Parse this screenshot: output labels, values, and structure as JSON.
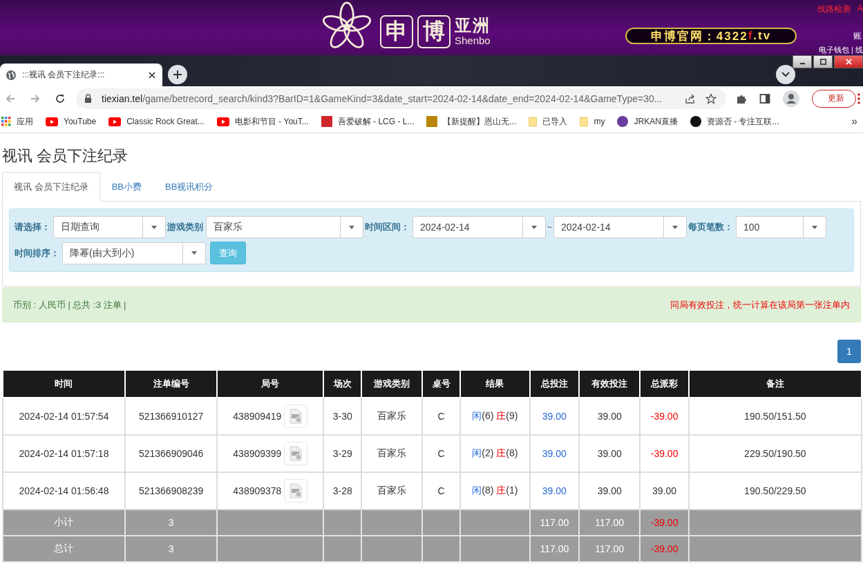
{
  "site_header": {
    "logo_characters": [
      "申",
      "博"
    ],
    "brand_cn": "亚洲",
    "brand_en": "Shenbo",
    "official_site": [
      "申博官网：4322",
      "f",
      ".tv"
    ],
    "top_links": [
      {
        "text": "线路检测",
        "kind": "link"
      },
      {
        "text": "A",
        "kind": "link"
      }
    ],
    "account_label": "账",
    "wallet_link": "电子钱包 | 线"
  },
  "browser": {
    "tab": {
      "title": ":::视讯 会员下注纪录:::"
    },
    "address": {
      "domain": "tiexian.tel",
      "path": "/game/betrecord_search/kind3?BarID=1&GameKind=3&date_start=2024-02-14&date_end=2024-02-14&GameType=30..."
    },
    "update_button": "更新",
    "bookmarks": [
      {
        "kind": "apps",
        "label": "应用"
      },
      {
        "kind": "video",
        "label": "YouTube"
      },
      {
        "kind": "video",
        "label": "Classic Rock Great..."
      },
      {
        "kind": "video",
        "label": "电影和节目 - YouT..."
      },
      {
        "kind": "site",
        "label": "吾爱破解 - LCG - L...",
        "color": "#d0272b"
      },
      {
        "kind": "site",
        "label": "【新提醒】恩山无...",
        "color": "#b8860b"
      },
      {
        "kind": "folder",
        "label": "已导入"
      },
      {
        "kind": "folder",
        "label": "my"
      },
      {
        "kind": "orb",
        "label": "JRKAN直播",
        "color": "#6a3d9a"
      },
      {
        "kind": "orb",
        "label": "资源否 - 专注互联...",
        "color": "#111111"
      }
    ],
    "more_bookmarks": "»"
  },
  "page": {
    "title": "视讯 会员下注纪录",
    "tabs": [
      {
        "label": "视讯 会员下注纪录",
        "selected": true
      },
      {
        "label": "BB小费",
        "selected": false
      },
      {
        "label": "BB视讯积分",
        "selected": false
      }
    ],
    "filter_rows": [
      [
        {
          "kind": "select",
          "label": "请选择：",
          "values": [
            "日期查询"
          ]
        },
        {
          "kind": "select",
          "label": "游戏类别",
          "values": [
            "百家乐"
          ]
        },
        {
          "kind": "select",
          "label": "时间区间：",
          "values": [
            "2024-02-14",
            "2024-02-14"
          ],
          "separator": "~"
        },
        {
          "kind": "select",
          "label": "每页笔数：",
          "values": [
            "100"
          ]
        }
      ],
      [
        {
          "kind": "select",
          "label": "时间排序：",
          "values": [
            "降幂(由大到小)"
          ]
        },
        {
          "kind": "button",
          "label": "查询"
        }
      ]
    ],
    "summary": "币别 : 人民币 | 总共 :3 注单 |",
    "notice": "同局有效投注，统一计算在该局第一张注单内",
    "pages": [
      {
        "label": "1",
        "selected": true
      }
    ],
    "table": {
      "columns": [
        "时间",
        "注单编号",
        "局号",
        "场次",
        "游戏类别",
        "桌号",
        "结果",
        "总投注",
        "有效投注",
        "总派彩",
        "备注"
      ],
      "rows": [
        {
          "time": "2024-02-14 01:57:54",
          "ticket": "521366910127",
          "round": "438909419",
          "session": "3-30",
          "game": "百家乐",
          "table": "C",
          "player": "闲",
          "player_score": "(6)",
          "banker": "庄",
          "banker_score": "(9)",
          "total_bet": "39.00",
          "valid_bet": "39.00",
          "payout": "-39.00",
          "payout_negative": true,
          "note": "190.50/151.50"
        },
        {
          "time": "2024-02-14 01:57:18",
          "ticket": "521366909046",
          "round": "438909399",
          "session": "3-29",
          "game": "百家乐",
          "table": "C",
          "player": "闲",
          "player_score": "(2)",
          "banker": "庄",
          "banker_score": "(8)",
          "total_bet": "39.00",
          "valid_bet": "39.00",
          "payout": "-39.00",
          "payout_negative": true,
          "note": "229.50/190.50"
        },
        {
          "time": "2024-02-14 01:56:48",
          "ticket": "521366908239",
          "round": "438909378",
          "session": "3-28",
          "game": "百家乐",
          "table": "C",
          "player": "闲",
          "player_score": "(8)",
          "banker": "庄",
          "banker_score": "(1)",
          "total_bet": "39.00",
          "valid_bet": "39.00",
          "payout": "39.00",
          "payout_negative": false,
          "note": "190.50/229.50"
        }
      ],
      "totals": [
        {
          "label": "小计",
          "count": "3",
          "total_bet": "117.00",
          "valid_bet": "117.00",
          "payout": "-39.00",
          "payout_negative": true
        },
        {
          "label": "总计",
          "count": "3",
          "total_bet": "117.00",
          "valid_bet": "117.00",
          "payout": "-39.00",
          "payout_negative": true
        }
      ]
    }
  }
}
